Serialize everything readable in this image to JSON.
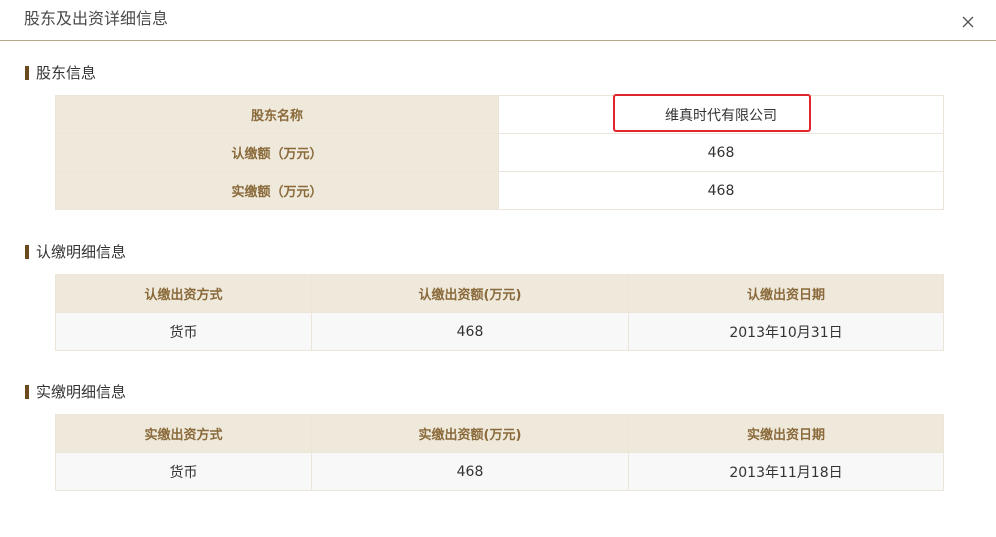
{
  "dialog": {
    "title": "股东及出资详细信息"
  },
  "colors": {
    "header_bg": "#efe9dc",
    "header_text": "#8a6a3a",
    "section_marker": "#6b4a1e",
    "highlight": "#e0262b",
    "divider": "#b8a88a"
  },
  "icons": {
    "close": "close-icon"
  },
  "shareholder": {
    "section_title": "股东信息",
    "rows": [
      {
        "label": "股东名称",
        "value": "维真时代有限公司"
      },
      {
        "label": "认缴额（万元）",
        "value": "468"
      },
      {
        "label": "实缴额（万元）",
        "value": "468"
      }
    ]
  },
  "subscribed": {
    "section_title": "认缴明细信息",
    "headers": [
      "认缴出资方式",
      "认缴出资额(万元)",
      "认缴出资日期"
    ],
    "rows": [
      [
        "货币",
        "468",
        "2013年10月31日"
      ]
    ]
  },
  "paid": {
    "section_title": "实缴明细信息",
    "headers": [
      "实缴出资方式",
      "实缴出资额(万元)",
      "实缴出资日期"
    ],
    "rows": [
      [
        "货币",
        "468",
        "2013年11月18日"
      ]
    ]
  }
}
